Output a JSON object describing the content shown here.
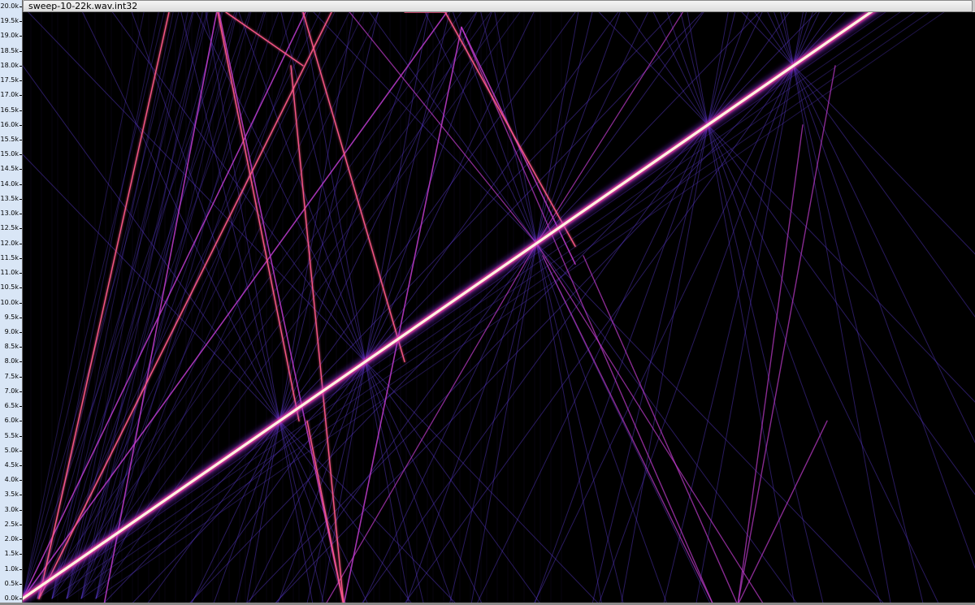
{
  "window": {
    "title": "sweep-10-22k.wav.int32"
  },
  "ruler": {
    "labels": [
      "20.0k",
      "19.5k",
      "19.0k",
      "18.5k",
      "18.0k",
      "17.5k",
      "17.0k",
      "16.5k",
      "16.0k",
      "15.5k",
      "15.0k",
      "14.5k",
      "14.0k",
      "13.5k",
      "13.0k",
      "12.5k",
      "12.0k",
      "11.5k",
      "11.0k",
      "10.5k",
      "10.0k",
      "9.5k",
      "9.0k",
      "8.5k",
      "8.0k",
      "7.5k",
      "7.0k",
      "6.5k",
      "6.0k",
      "5.5k",
      "5.0k",
      "4.5k",
      "4.0k",
      "3.5k",
      "3.0k",
      "2.5k",
      "2.0k",
      "1.5k",
      "1.0k",
      "0.5k",
      "0.0k"
    ]
  },
  "colors": {
    "ruler_bg": "#d9e6f6",
    "background": "#000000",
    "main_sweep": "#fff2e0",
    "harmonic_hot": "#ff5a8a",
    "harmonic_mid": "#c03ccf",
    "harmonic_dim": "#5a3ad0"
  }
}
